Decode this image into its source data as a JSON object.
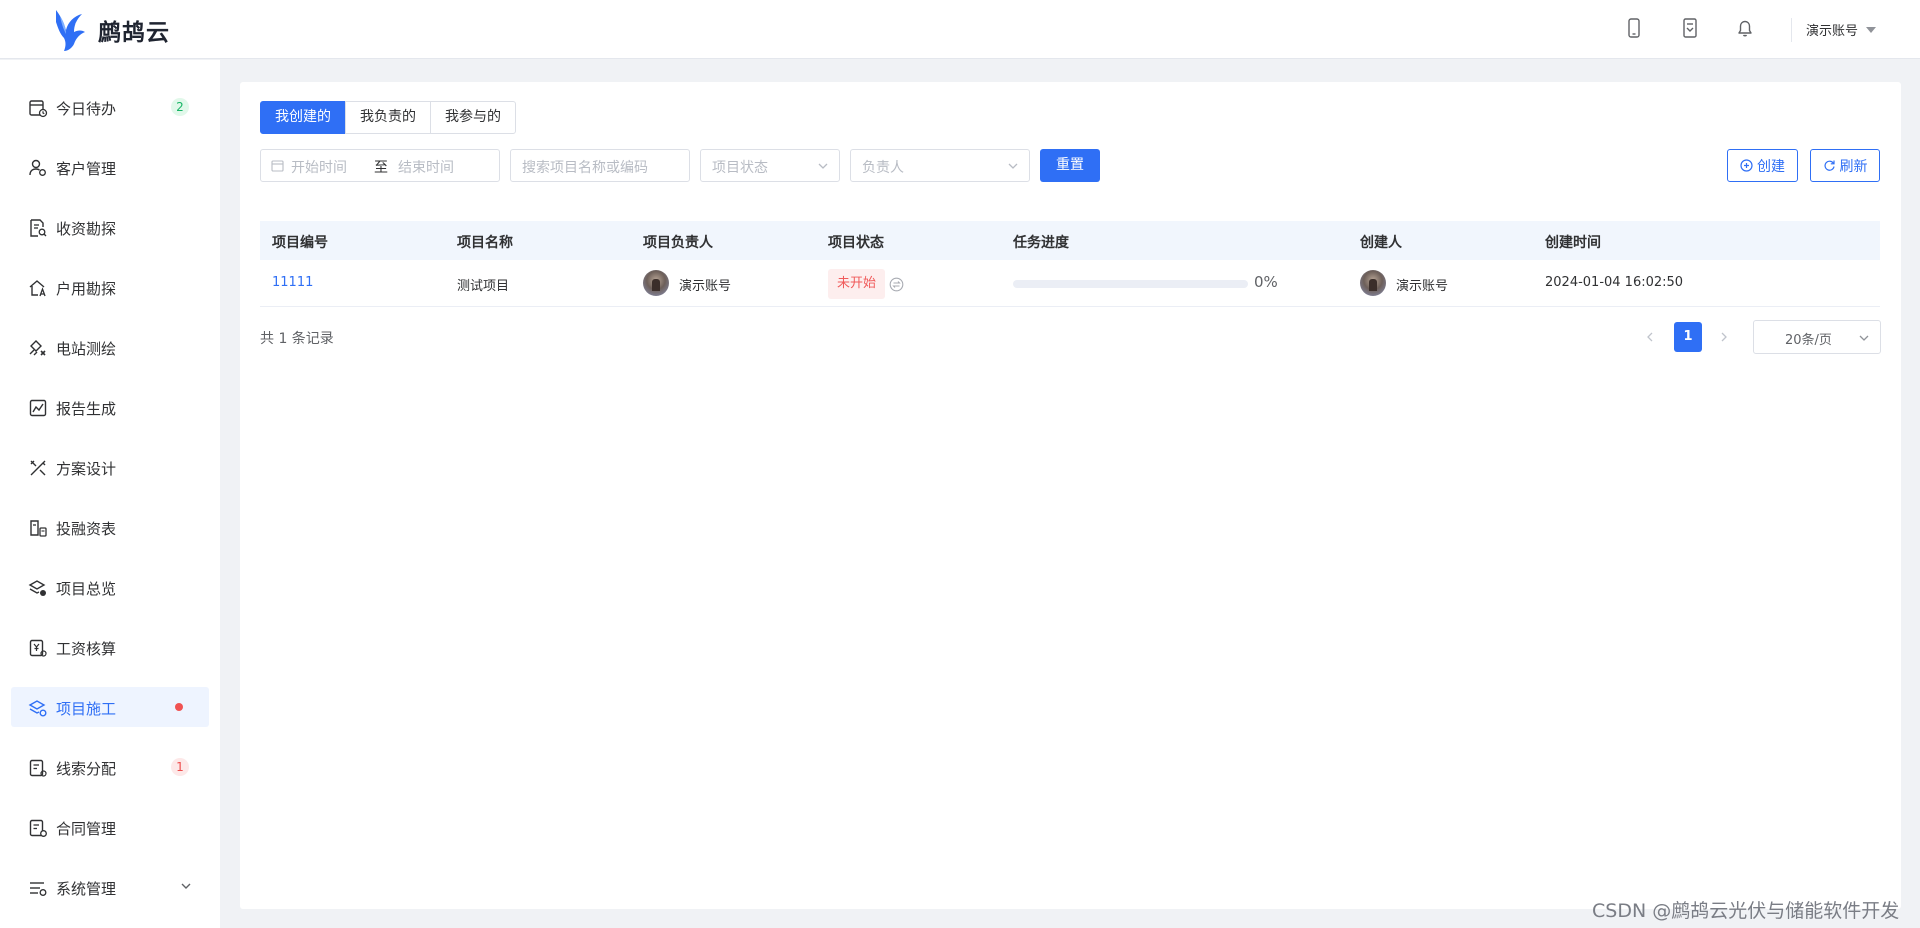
{
  "header": {
    "brand_name": "鹧鸪云",
    "user_name": "演示账号",
    "icons": [
      "mobile-icon",
      "document-icon",
      "bell-icon"
    ]
  },
  "sidebar": {
    "items": [
      {
        "label": "今日待办",
        "icon": "calendar-todo-icon",
        "badge": "2"
      },
      {
        "label": "客户管理",
        "icon": "customer-gear-icon"
      },
      {
        "label": "收资勘探",
        "icon": "document-search-icon"
      },
      {
        "label": "户用勘探",
        "icon": "house-icon"
      },
      {
        "label": "电站测绘",
        "icon": "station-survey-icon"
      },
      {
        "label": "报告生成",
        "icon": "report-chart-icon"
      },
      {
        "label": "方案设计",
        "icon": "design-tools-icon"
      },
      {
        "label": "投融资表",
        "icon": "finance-table-icon"
      },
      {
        "label": "项目总览",
        "icon": "layers-overview-icon"
      },
      {
        "label": "工资核算",
        "icon": "payroll-icon"
      },
      {
        "label": "项目施工",
        "icon": "layers-construction-icon",
        "active": true
      },
      {
        "label": "线索分配",
        "icon": "clue-list-icon",
        "badge": "1"
      },
      {
        "label": "合同管理",
        "icon": "contract-icon"
      },
      {
        "label": "系统管理",
        "icon": "settings-sliders-icon"
      }
    ],
    "accent_color": "#2f6ff5"
  },
  "tabs": [
    {
      "label": "我创建的",
      "active": true
    },
    {
      "label": "我负责的"
    },
    {
      "label": "我参与的"
    }
  ],
  "filters": {
    "start_placeholder": "开始时间",
    "range_separator": "至",
    "end_placeholder": "结束时间",
    "search_placeholder": "搜索项目名称或编码",
    "status_placeholder": "项目状态",
    "owner_placeholder": "负责人",
    "reset_label": "重置",
    "create_label": "创建",
    "refresh_label": "刷新"
  },
  "table": {
    "columns": [
      "项目编号",
      "项目名称",
      "项目负责人",
      "项目状态",
      "任务进度",
      "创建人",
      "创建时间"
    ],
    "rows": [
      {
        "code": "11111",
        "name": "测试项目",
        "owner": "演示账号",
        "status": "未开始",
        "progress": 0,
        "progress_text": "0%",
        "creator": "演示账号",
        "created_at": "2024-01-04 16:02:50"
      }
    ]
  },
  "pagination": {
    "total_text": "共 1 条记录",
    "current_page": "1",
    "page_size": "20条/页"
  },
  "watermark": "CSDN @鹧鸪云光伏与储能软件开发"
}
